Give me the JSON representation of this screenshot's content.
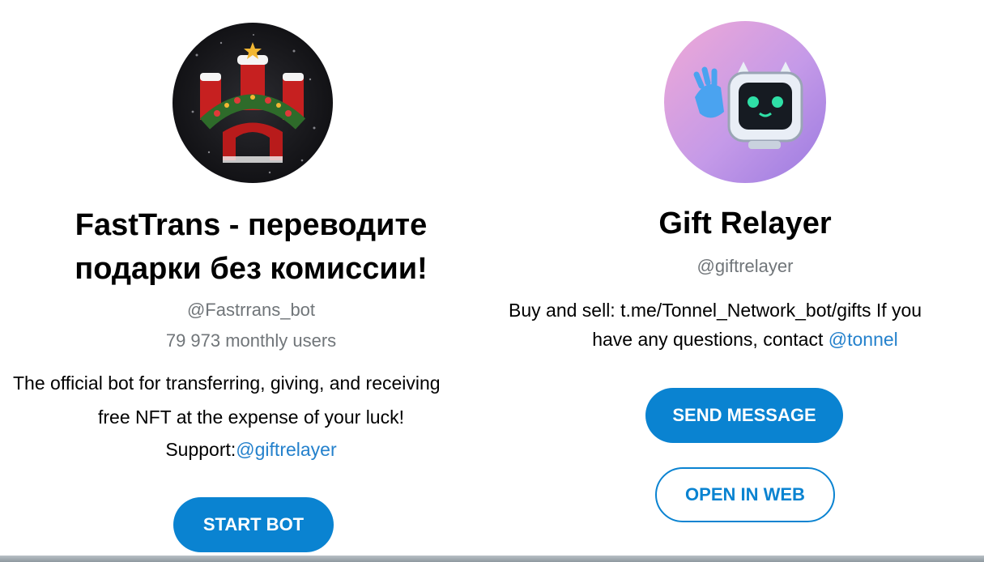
{
  "left_card": {
    "title_line1": "FastTrans - переводите",
    "title_line2": "подарки без комиссии!",
    "username": "@Fastrrans_bot",
    "monthly_users": "79 973 monthly users",
    "description_line1": "The official bot for transferring, giving, and receiving",
    "description_line2": "free NFT at the expense of your luck!",
    "support_prefix": "Support:",
    "support_link": "@giftrelayer",
    "button_label": "START BOT",
    "avatar_icon": "christmas-castle-avatar-icon"
  },
  "right_card": {
    "title": "Gift Relayer",
    "username": "@giftrelayer",
    "description_line1": "Buy and sell: t.me/Tonnel_Network_bot/gifts If you",
    "description_prefix": "have any questions, contact ",
    "contact_link": "@tonnel",
    "send_button_label": "SEND MESSAGE",
    "web_button_label": "OPEN IN WEB",
    "avatar_icon": "robot-cat-waving-avatar-icon"
  },
  "colors": {
    "accent": "#0a83d1",
    "link": "#2481cc",
    "muted": "#707579"
  }
}
